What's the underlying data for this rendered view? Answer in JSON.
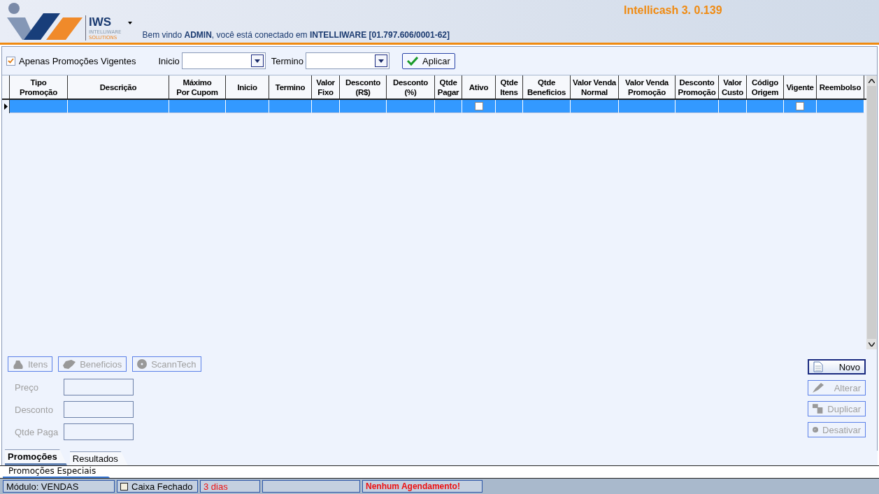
{
  "header": {
    "brand": "IWS",
    "brand_sub_1": "INTELLIWARE",
    "brand_sub_2": "SOLUTIONS",
    "app_version": "Intellicash 3. 0.139",
    "welcome": "Bem vindo **ADMIN**, você está conectado em **INTELLIWARE [01.797.606/0001-62]**"
  },
  "filter": {
    "only_current": {
      "label": "Apenas Promoções Vigentes",
      "checked": true
    },
    "start_label": "Inicio",
    "end_label": "Termino",
    "apply": "Aplicar"
  },
  "table": {
    "columns": [
      {
        "label": "Tipo\nPromoção",
        "kind": "text"
      },
      {
        "label": "Descrição",
        "kind": "text"
      },
      {
        "label": "Máximo\nPor Cupom",
        "kind": "text"
      },
      {
        "label": "Inicio",
        "kind": "text"
      },
      {
        "label": "Termino",
        "kind": "text"
      },
      {
        "label": "Valor\nFixo",
        "kind": "text"
      },
      {
        "label": "Desconto\n(R$)",
        "kind": "text"
      },
      {
        "label": "Desconto\n(%)",
        "kind": "text"
      },
      {
        "label": "Qtde\nPagar",
        "kind": "text"
      },
      {
        "label": "Ativo",
        "kind": "check"
      },
      {
        "label": "Qtde\nItens",
        "kind": "text"
      },
      {
        "label": "Qtde\nBeneficios",
        "kind": "text"
      },
      {
        "label": "Valor Venda\nNormal",
        "kind": "text"
      },
      {
        "label": "Valor Venda\nPromoção",
        "kind": "text"
      },
      {
        "label": "Desconto\nPromoção",
        "kind": "text"
      },
      {
        "label": "Valor\nCusto",
        "kind": "text"
      },
      {
        "label": "Código\nOrigem",
        "kind": "text"
      },
      {
        "label": "Vigente",
        "kind": "check"
      },
      {
        "label": "Reembolso",
        "kind": "text"
      }
    ],
    "rows": [
      {
        "selected": true,
        "checks": [
          false,
          false
        ]
      }
    ]
  },
  "detail_buttons": [
    {
      "label": "Itens",
      "kind": "items",
      "disabled": true
    },
    {
      "label": "Beneficios",
      "kind": "benefits",
      "disabled": true
    },
    {
      "label": "ScannTech",
      "kind": "scanntech",
      "disabled": true
    }
  ],
  "detail_fields": [
    {
      "label": "Preço",
      "disabled": true
    },
    {
      "label": "Desconto",
      "disabled": true
    },
    {
      "label": "Qtde Paga",
      "disabled": true
    }
  ],
  "action_buttons": [
    {
      "label": "Novo",
      "kind": "new",
      "disabled": false
    },
    {
      "label": "Alterar",
      "kind": "edit",
      "disabled": true
    },
    {
      "label": "Duplicar",
      "kind": "duplicate",
      "disabled": true
    },
    {
      "label": "Desativar",
      "kind": "deactivate",
      "disabled": true
    }
  ],
  "tabs": [
    {
      "label": "Promoções",
      "selected": true
    },
    {
      "label": "Resultados",
      "selected": false
    }
  ],
  "module_tabs": [
    {
      "label": "Promoções Especiais",
      "selected": true
    }
  ],
  "status_bar": [
    {
      "kind": "text",
      "text": "Módulo: VENDAS"
    },
    {
      "kind": "check",
      "text": "Caixa Fechado",
      "checked": false
    },
    {
      "kind": "alert",
      "text": "3 dias"
    },
    {
      "kind": "empty"
    },
    {
      "kind": "alert-bold",
      "text": "Nenhum Agendamento!"
    }
  ]
}
